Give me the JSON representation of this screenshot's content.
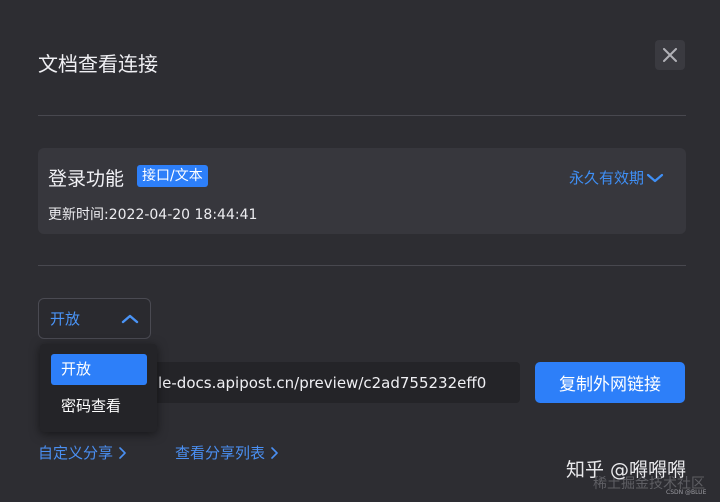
{
  "dialog": {
    "title": "文档查看连接",
    "close_icon": "close-icon"
  },
  "card": {
    "title": "登录功能",
    "tag": "接口/文本",
    "update_time": "更新时间:2022-04-20 18:44:41",
    "validity": "永久有效期"
  },
  "access": {
    "selected": "开放",
    "options": [
      "开放",
      "密码查看"
    ]
  },
  "url": {
    "value": "le-docs.apipost.cn/preview/c2ad755232eff0"
  },
  "copy_button": "复制外网链接",
  "links": {
    "custom_share": "自定义分享",
    "share_list": "查看分享列表"
  },
  "watermark": {
    "main": "知乎 @嘚嘚嘚",
    "sub": "稀土掘金技术社区",
    "csdn": "CSDN @BLUE"
  },
  "colors": {
    "accent": "#2d7ff9",
    "link": "#4a8ff2",
    "background": "#2d2d32"
  }
}
